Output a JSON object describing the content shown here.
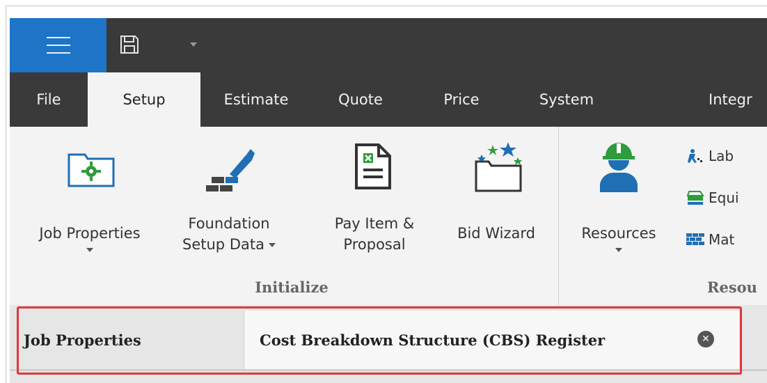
{
  "quick_access": {
    "menu_icon": "hamburger-icon",
    "save_icon": "floppy-save-icon",
    "dropdown_icon": "chevron-down-icon"
  },
  "tabs": [
    {
      "label": "File"
    },
    {
      "label": "Setup",
      "active": true
    },
    {
      "label": "Estimate"
    },
    {
      "label": "Quote"
    },
    {
      "label": "Price"
    },
    {
      "label": "System"
    },
    {
      "label": "Integr"
    }
  ],
  "ribbon": {
    "initialize": {
      "group_label": "Initialize",
      "buttons": [
        {
          "label": "Job Properties",
          "icon": "folder-gear-icon",
          "has_dropdown": true
        },
        {
          "label_line1": "Foundation",
          "label_line2": "Setup Data",
          "icon": "foundation-trowel-icon",
          "has_dropdown": true
        },
        {
          "label_line1": "Pay Item &",
          "label_line2": "Proposal",
          "icon": "spreadsheet-document-icon",
          "has_dropdown": false
        },
        {
          "label": "Bid Wizard",
          "icon": "folder-stars-icon",
          "has_dropdown": false
        }
      ]
    },
    "resources": {
      "group_label": "Resou",
      "resources_button": {
        "label": "Resources",
        "icon": "hard-hat-worker-icon",
        "has_dropdown": true
      },
      "small_items": [
        {
          "label": "Lab",
          "icon": "labor-worker-icon"
        },
        {
          "label": "Equi",
          "icon": "equipment-icon"
        },
        {
          "label": "Mat",
          "icon": "materials-bricks-icon"
        }
      ]
    }
  },
  "document_tabs": [
    {
      "label": "Job Properties",
      "active": false
    },
    {
      "label": "Cost Breakdown Structure (CBS) Register",
      "active": true,
      "closable": true
    }
  ],
  "colors": {
    "accent_blue": "#1e74c6",
    "dark_chrome": "#3a3a3a",
    "highlight_red": "#e2363b",
    "icon_blue": "#1f6fb5",
    "icon_green": "#2e9c3c"
  }
}
